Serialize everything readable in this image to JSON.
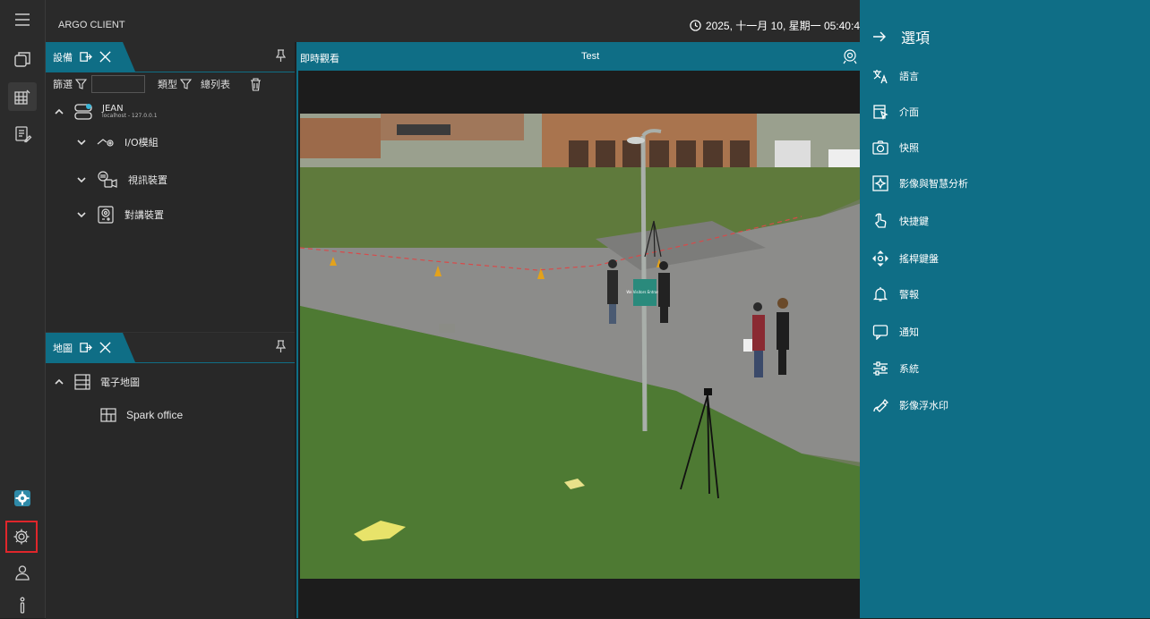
{
  "app": {
    "title": "ARGO CLIENT",
    "clock": "2025, 十一月 10, 星期一 05:40:4"
  },
  "devices_panel": {
    "tab_label": "設備",
    "filter_label": "篩選",
    "filter_value": "",
    "type_label": "類型",
    "list_label": "總列表",
    "server": {
      "name": "JEAN",
      "address": "localhost - 127.0.0.1"
    },
    "groups": [
      {
        "label": "I/O模組"
      },
      {
        "label": "視訊裝置"
      },
      {
        "label": "對講裝置"
      }
    ]
  },
  "map_panel": {
    "tab_label": "地圖",
    "root_label": "電子地圖",
    "child_label": "Spark office"
  },
  "video": {
    "header_label": "即時觀看",
    "camera_name": "Test",
    "sign_text": "We Visitors Entrance"
  },
  "options_panel": {
    "title": "選項",
    "items": [
      {
        "label": "語言",
        "icon": "translate-icon"
      },
      {
        "label": "介面",
        "icon": "interface-icon"
      },
      {
        "label": "快照",
        "icon": "camera-icon"
      },
      {
        "label": "影像與智慧分析",
        "icon": "image-analytics-icon"
      },
      {
        "label": "快捷鍵",
        "icon": "hand-pointer-icon"
      },
      {
        "label": "搖桿鍵盤",
        "icon": "joystick-icon"
      },
      {
        "label": "警報",
        "icon": "bell-icon"
      },
      {
        "label": "通知",
        "icon": "chat-icon"
      },
      {
        "label": "系統",
        "icon": "sliders-icon"
      },
      {
        "label": "影像浮水印",
        "icon": "watermark-icon"
      }
    ]
  },
  "colors": {
    "accent": "#0f6e86",
    "highlight": "#e0262b"
  }
}
